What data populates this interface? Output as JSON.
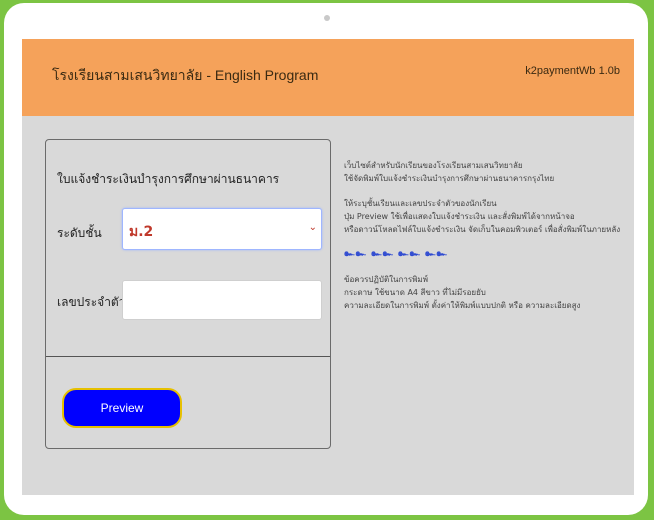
{
  "header": {
    "site_title": "โรงเรียนสามเสนวิทยาลัย - English Program",
    "version": "k2paymentWb 1.0b"
  },
  "form": {
    "title": "ใบแจ้งชำระเงินบำรุงการศึกษาผ่านธนาคาร",
    "level_label": "ระดับชั้น",
    "level_value": "ม.2",
    "student_id_label": "เลขประจำตัว",
    "student_id_value": "",
    "preview_label": "Preview"
  },
  "info": {
    "line1": "เว็บไซต์สำหรับนักเรียนของโรงเรียนสามเสนวิทยาลัย",
    "line2": "ใช้จัดพิมพ์ใบแจ้งชำระเงินบำรุงการศึกษาผ่านธนาคารกรุงไทย",
    "line3": "ให้ระบุชั้นเรียนและเลขประจำตัวของนักเรียน",
    "line4": "ปุ่ม Preview ใช้เพื่อแสดงใบแจ้งชำระเงิน และสั่งพิมพ์ได้จากหน้าจอ",
    "line5": "หรือดาวน์โหลดไฟล์ใบแจ้งชำระเงิน จัดเก็บในคอมพิวเตอร์ เพื่อสั่งพิมพ์ในภายหลัง",
    "separator": "๛๛ ๛๛ ๛๛ ๛๛",
    "line6": "ข้อควรปฏิบัติในการพิมพ์",
    "line7": "กระดาษ ใช้ขนาด A4 สีขาว ที่ไม่มีรอยยับ",
    "line8": "ความละเอียดในการพิมพ์ ตั้งค่าให้พิมพ์แบบปกติ หรือ ความละเอียดสูง"
  }
}
